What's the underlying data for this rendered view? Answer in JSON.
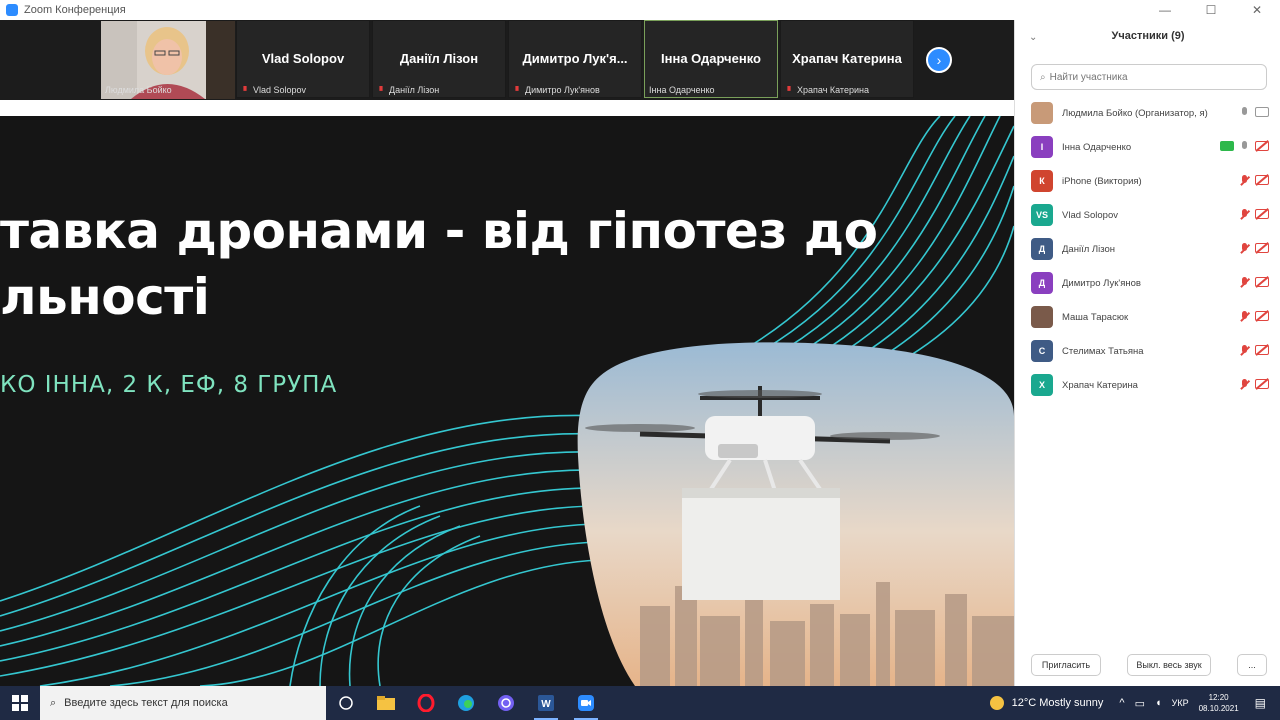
{
  "window": {
    "title": "Zoom Конференция"
  },
  "gallery": {
    "tiles": [
      {
        "name": "",
        "caption": "Людмила Бойко",
        "video": true
      },
      {
        "name": "Vlad Solopov",
        "caption": "Vlad Solopov"
      },
      {
        "name": "Даніїл Лізон",
        "caption": "Даніїл Лізон"
      },
      {
        "name": "Димитро Лук'я...",
        "caption": "Димитро Лук'янов"
      },
      {
        "name": "Інна Одарченко",
        "caption": "Інна Одарченко",
        "active": true
      },
      {
        "name": "Храпач Катерина",
        "caption": "Храпач Катерина"
      }
    ],
    "next_icon": "chevron-right-icon"
  },
  "slide": {
    "title_line1": "тавка дронами - від гіпотез до",
    "title_line2": "льності",
    "subtitle": "КО ІННА, 2 К, ЕФ, 8 ГРУПА",
    "accent_color": "#3ec8c0"
  },
  "participants": {
    "header": "Участники (9)",
    "search_placeholder": "Найти участника",
    "list": [
      {
        "initial": "",
        "name": "Людмила Бойко (Организатор, я)",
        "color": "#c89a78",
        "mic": "on",
        "cam": "on",
        "photo": true
      },
      {
        "initial": "І",
        "name": "Інна Одарченко",
        "color": "#8a3fbf",
        "mic": "on",
        "cam": "video",
        "photo": false
      },
      {
        "initial": "К",
        "name": "iPhone (Виктория)",
        "color": "#d0452f",
        "mic": "muted",
        "cam": "muted",
        "photo": false
      },
      {
        "initial": "VS",
        "name": "Vlad Solopov",
        "color": "#1aa88f",
        "mic": "muted",
        "cam": "muted",
        "photo": false
      },
      {
        "initial": "Д",
        "name": "Даніїл Лізон",
        "color": "#3f5b85",
        "mic": "muted",
        "cam": "muted",
        "photo": false
      },
      {
        "initial": "Д",
        "name": "Димитро Лук'янов",
        "color": "#8a3fbf",
        "mic": "muted",
        "cam": "muted",
        "photo": false
      },
      {
        "initial": "",
        "name": "Маша Тарасюк",
        "color": "#7a5a4a",
        "mic": "muted",
        "cam": "muted",
        "photo": true
      },
      {
        "initial": "С",
        "name": "Стелимах Татьяна",
        "color": "#3f5b85",
        "mic": "muted",
        "cam": "muted",
        "photo": false
      },
      {
        "initial": "Х",
        "name": "Храпач Катерина",
        "color": "#1aa88f",
        "mic": "muted",
        "cam": "muted",
        "photo": false
      }
    ],
    "invite_label": "Пригласить",
    "mute_all_label": "Выкл. весь звук",
    "more_label": "..."
  },
  "taskbar": {
    "search_placeholder": "Введите здесь текст для поиска",
    "weather": "12°C  Mostly sunny",
    "lang": "УКР",
    "time": "12:20",
    "date": "08.10.2021"
  }
}
